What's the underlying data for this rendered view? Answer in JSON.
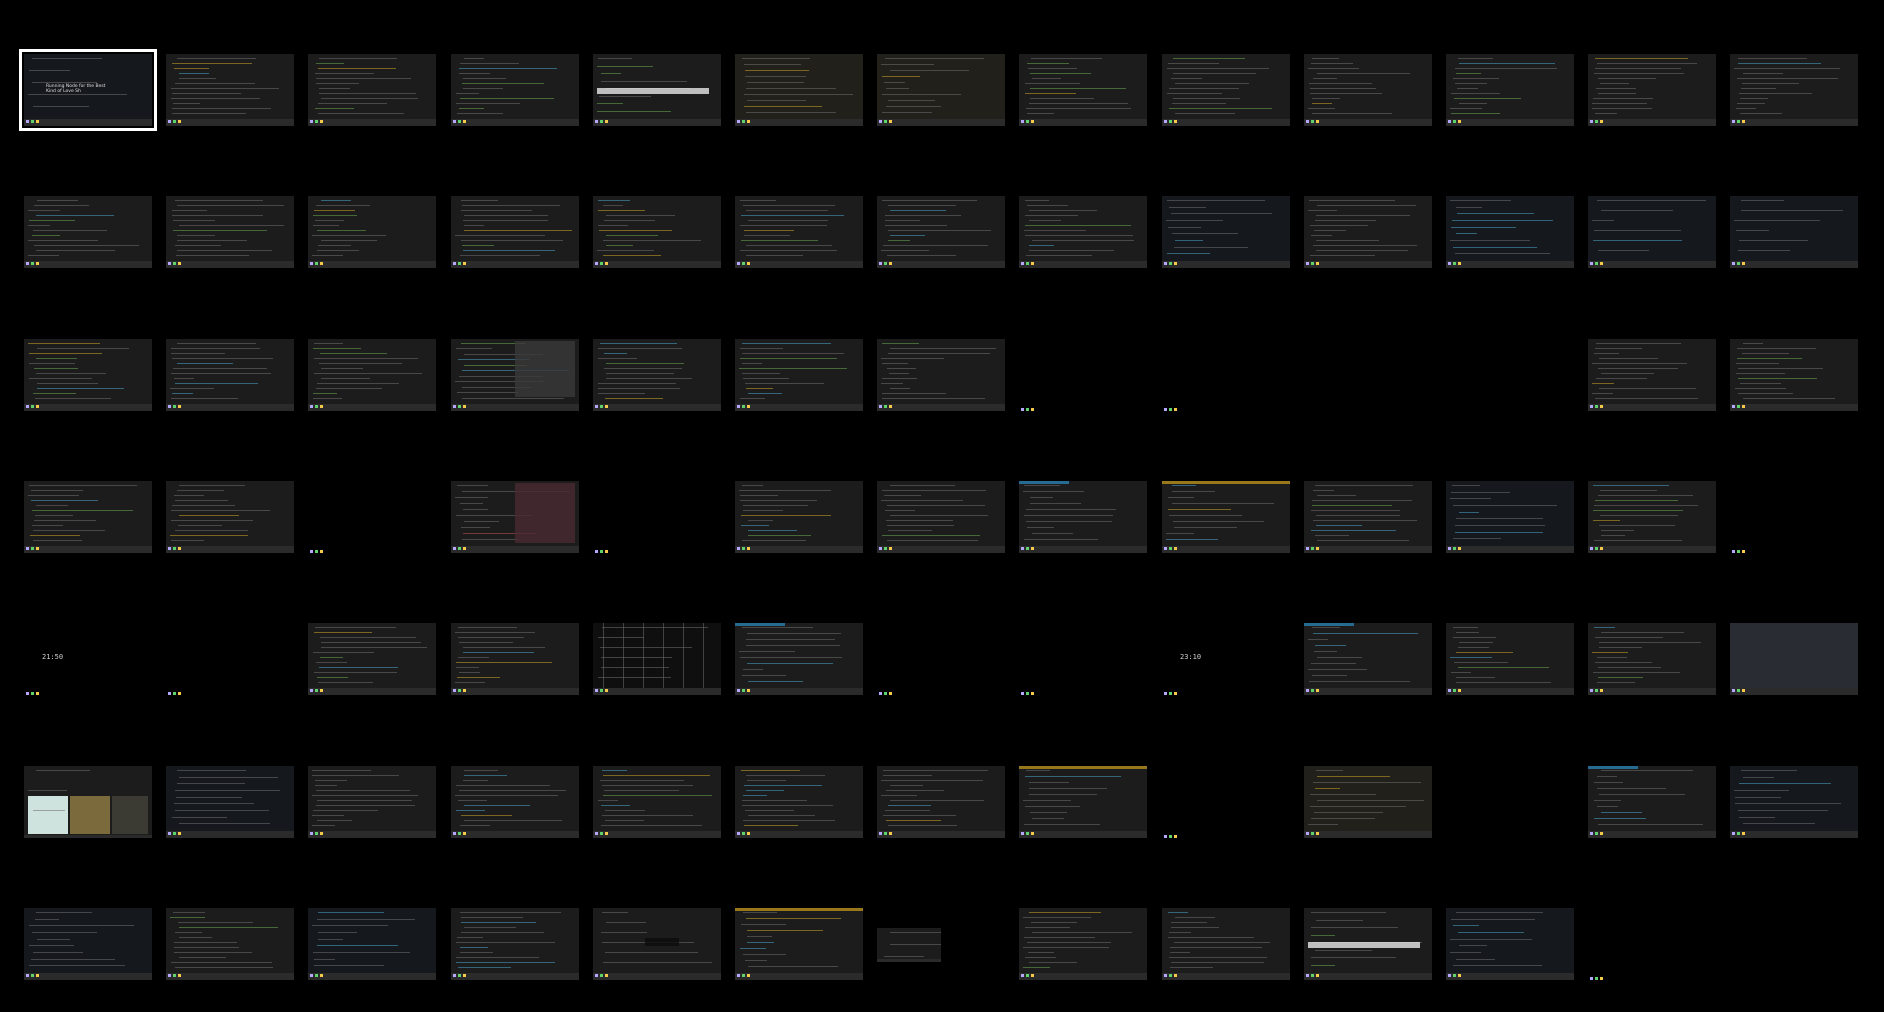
{
  "overview": {
    "title": "",
    "selected_index": 0,
    "columns": 13,
    "rows": 7
  },
  "tiles": [
    {
      "kind": "doc",
      "title": "Running Node for the Best\nKind of Love Sh",
      "selected": true
    },
    {
      "kind": "term"
    },
    {
      "kind": "term"
    },
    {
      "kind": "term"
    },
    {
      "kind": "term-light"
    },
    {
      "kind": "term-alt"
    },
    {
      "kind": "term-alt"
    },
    {
      "kind": "term"
    },
    {
      "kind": "term"
    },
    {
      "kind": "term"
    },
    {
      "kind": "term"
    },
    {
      "kind": "term"
    },
    {
      "kind": "term"
    },
    {
      "kind": "term"
    },
    {
      "kind": "term"
    },
    {
      "kind": "term"
    },
    {
      "kind": "term"
    },
    {
      "kind": "term"
    },
    {
      "kind": "term"
    },
    {
      "kind": "term"
    },
    {
      "kind": "term"
    },
    {
      "kind": "doc-dark"
    },
    {
      "kind": "term"
    },
    {
      "kind": "doc-dark"
    },
    {
      "kind": "deep"
    },
    {
      "kind": "deep"
    },
    {
      "kind": "term"
    },
    {
      "kind": "term"
    },
    {
      "kind": "term"
    },
    {
      "kind": "term-split"
    },
    {
      "kind": "term"
    },
    {
      "kind": "term"
    },
    {
      "kind": "term"
    },
    {
      "kind": "blank"
    },
    {
      "kind": "blank"
    },
    {
      "kind": "empty"
    },
    {
      "kind": "empty"
    },
    {
      "kind": "term"
    },
    {
      "kind": "term"
    },
    {
      "kind": "term"
    },
    {
      "kind": "term"
    },
    {
      "kind": "blank"
    },
    {
      "kind": "term-red"
    },
    {
      "kind": "blank"
    },
    {
      "kind": "term"
    },
    {
      "kind": "term"
    },
    {
      "kind": "term-blue"
    },
    {
      "kind": "term-yellow"
    },
    {
      "kind": "term"
    },
    {
      "kind": "doc-dark"
    },
    {
      "kind": "term"
    },
    {
      "kind": "blank"
    },
    {
      "kind": "clock",
      "time": "21:50"
    },
    {
      "kind": "blank"
    },
    {
      "kind": "term"
    },
    {
      "kind": "term"
    },
    {
      "kind": "grid-dark"
    },
    {
      "kind": "term-blue"
    },
    {
      "kind": "blank"
    },
    {
      "kind": "blank"
    },
    {
      "kind": "clock",
      "time": "23:10"
    },
    {
      "kind": "term-blue"
    },
    {
      "kind": "term"
    },
    {
      "kind": "term"
    },
    {
      "kind": "slate"
    },
    {
      "kind": "photos"
    },
    {
      "kind": "doc-dark"
    },
    {
      "kind": "term"
    },
    {
      "kind": "term"
    },
    {
      "kind": "term"
    },
    {
      "kind": "term"
    },
    {
      "kind": "term"
    },
    {
      "kind": "term-yellow"
    },
    {
      "kind": "blank"
    },
    {
      "kind": "term-alt"
    },
    {
      "kind": "empty"
    },
    {
      "kind": "term-blue"
    },
    {
      "kind": "doc-dark"
    },
    {
      "kind": "doc-dark"
    },
    {
      "kind": "term"
    },
    {
      "kind": "doc-dark"
    },
    {
      "kind": "term"
    },
    {
      "kind": "term-dialog"
    },
    {
      "kind": "term-yellow"
    },
    {
      "kind": "mini"
    },
    {
      "kind": "term"
    },
    {
      "kind": "term"
    },
    {
      "kind": "term-light"
    },
    {
      "kind": "doc-dark"
    },
    {
      "kind": "blank"
    },
    {
      "kind": "empty"
    }
  ],
  "colors": {
    "background": "#000000",
    "selection": "#ffffff",
    "terminal_bg": "#1c1c1c",
    "accent_blue": "#2b7fb0",
    "accent_green": "#5fd36b",
    "accent_yellow": "#f5c94a",
    "accent_purple": "#b3a7ff"
  }
}
